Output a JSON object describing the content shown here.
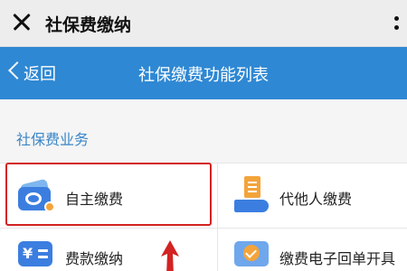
{
  "window": {
    "title": "社保费缴纳"
  },
  "navbar": {
    "back_label": "返回",
    "title": "社保缴费功能列表"
  },
  "section": {
    "title": "社保费业务"
  },
  "services": [
    {
      "label": "自主缴费",
      "icon": "wallet-icon"
    },
    {
      "label": "代他人缴费",
      "icon": "pay-for-others-icon"
    },
    {
      "label": "费款缴纳",
      "icon": "yen-card-icon"
    },
    {
      "label": "缴费电子回单开具",
      "icon": "e-receipt-icon"
    }
  ],
  "colors": {
    "navbar_bg": "#2f88d3",
    "section_title": "#3a86c8",
    "highlight": "#d32222",
    "icon_blue": "#3b7ee0",
    "icon_orange": "#f3a43b"
  }
}
